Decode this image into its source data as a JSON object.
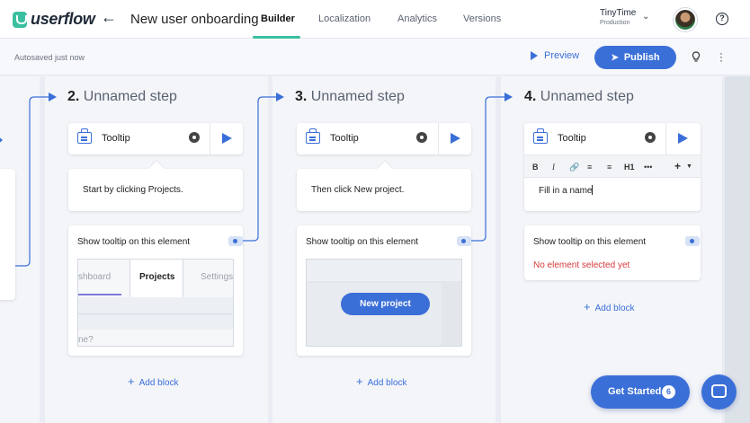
{
  "app": {
    "logo_text": "userflow"
  },
  "header": {
    "flow_title": "New user onboarding",
    "tabs": [
      {
        "label": "Builder",
        "active": true
      },
      {
        "label": "Localization"
      },
      {
        "label": "Analytics"
      },
      {
        "label": "Versions"
      }
    ],
    "environment": {
      "name": "TinyTime",
      "subtitle": "Production"
    }
  },
  "subbar": {
    "status": "Autosaved just now",
    "preview_label": "Preview",
    "publish_label": "Publish"
  },
  "steps": [
    {
      "number": "2.",
      "title": "Unnamed step",
      "block_type": "Tooltip",
      "text": "Start by clicking Projects.",
      "target_label": "Show tooltip on this element",
      "thumb_tabs": [
        "shboard",
        "Projects",
        "Settings"
      ],
      "thumb_input": "ne?",
      "add_block": "Add block"
    },
    {
      "number": "3.",
      "title": "Unnamed step",
      "block_type": "Tooltip",
      "text": "Then click New project.",
      "target_label": "Show tooltip on this element",
      "thumb_button": "New project",
      "add_block": "Add block"
    },
    {
      "number": "4.",
      "title": "Unnamed step",
      "block_type": "Tooltip",
      "text": "Fill in a name",
      "target_label": "Show tooltip on this element",
      "error": "No element selected yet",
      "add_block": "Add block",
      "toolbar": [
        "B",
        "I",
        "H1",
        "•••",
        "+"
      ]
    }
  ],
  "widgets": {
    "get_started": "Get Started",
    "get_started_count": "6"
  },
  "colors": {
    "accent": "#3b6fd8",
    "brand": "#3ac0a0",
    "error": "#d63a3a"
  }
}
